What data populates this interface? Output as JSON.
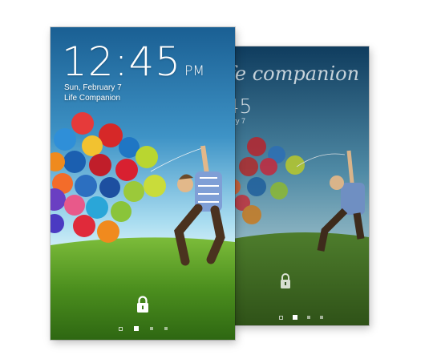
{
  "front_screen": {
    "time": "12:45",
    "ampm": "PM",
    "date": "Sun, February 7",
    "owner_info": "Life Companion",
    "lock_icon": "padlock-icon",
    "page_indicator": {
      "pages": 4,
      "current": 2
    }
  },
  "back_screen": {
    "owner_info_partial": "fe companion",
    "time_partial": ":45",
    "date_partial": "ebruary 7",
    "lock_icon": "padlock-icon",
    "page_indicator": {
      "pages": 4,
      "current": 2
    }
  },
  "colors": {
    "sky_top": "#1f6ea8",
    "sky_bottom": "#c9eaf7",
    "grass": "#4c8f1e",
    "text": "#ffffff"
  }
}
